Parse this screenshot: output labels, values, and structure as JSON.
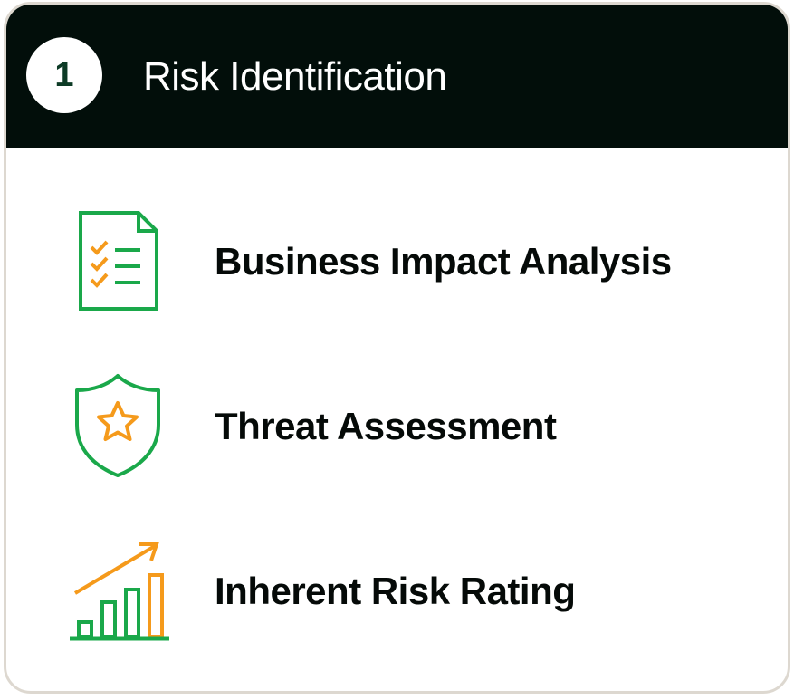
{
  "header": {
    "step_number": "1",
    "title": "Risk Identification"
  },
  "colors": {
    "header_bg": "#020e0a",
    "accent_green": "#1aa84a",
    "accent_orange": "#f59a1b",
    "border": "#ddd8d0"
  },
  "items": [
    {
      "label": "Business Impact Analysis",
      "icon": "checklist-document-icon"
    },
    {
      "label": "Threat Assessment",
      "icon": "shield-star-icon"
    },
    {
      "label": "Inherent Risk Rating",
      "icon": "growth-chart-icon"
    }
  ]
}
